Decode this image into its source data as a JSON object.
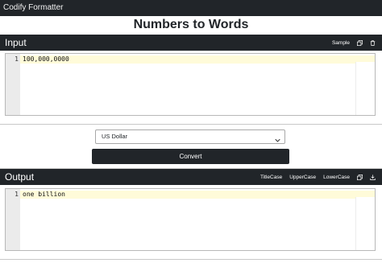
{
  "app": {
    "title": "Codify Formatter"
  },
  "page": {
    "title": "Numbers to Words"
  },
  "input_panel": {
    "title": "Input",
    "sample_label": "Sample",
    "copy_icon": "copy-icon",
    "delete_icon": "trash-icon",
    "line_number": "1",
    "value": "100,000,0000"
  },
  "options": {
    "currency": "US Dollar",
    "convert_label": "Convert"
  },
  "output_panel": {
    "title": "Output",
    "titlecase_label": "TitleCase",
    "uppercase_label": "UpperCase",
    "lowercase_label": "LowerCase",
    "copy_icon": "copy-icon",
    "download_icon": "download-icon",
    "line_number": "1",
    "value": "one billion"
  },
  "colors": {
    "dark": "#212529",
    "active_line": "#fffbd9",
    "gutter": "#ebebeb"
  }
}
